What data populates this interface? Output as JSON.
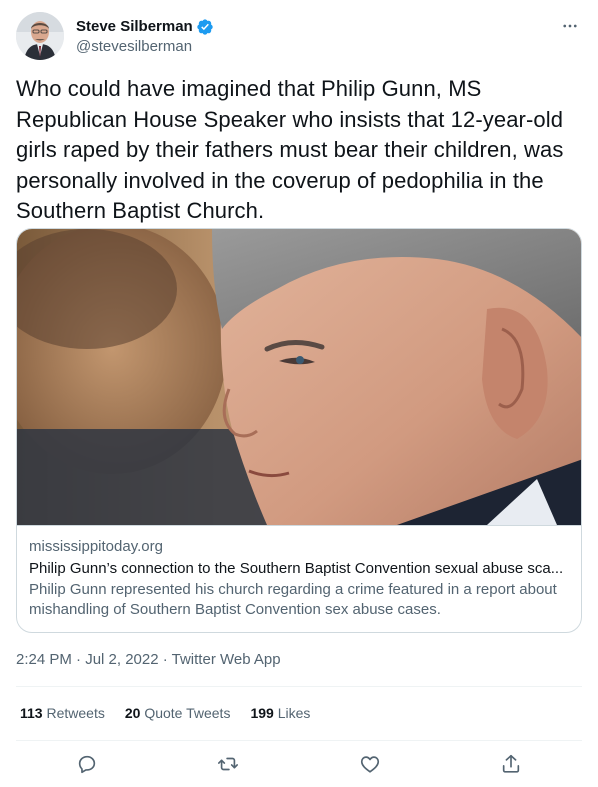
{
  "author": {
    "display_name": "Steve Silberman",
    "handle": "@stevesilberman",
    "verified": true
  },
  "tweet": {
    "text": "Who could have imagined that Philip Gunn, MS Republican House Speaker who insists that 12-year-old girls raped by their fathers must bear their children, was personally involved in the coverup of pedophilia in the Southern Baptist Church."
  },
  "card": {
    "domain": "mississippitoday.org",
    "title": "Philip Gunn’s connection to the Southern Baptist Convention sexual abuse sca...",
    "description": "Philip Gunn represented his church regarding a crime featured in a report about mishandling of Southern Baptist Convention sex abuse cases."
  },
  "meta": {
    "timestamp": "2:24 PM · Jul 2, 2022 · Twitter Web App"
  },
  "stats": {
    "retweets_count": "113",
    "retweets_label": "Retweets",
    "quotes_count": "20",
    "quotes_label": "Quote Tweets",
    "likes_count": "199",
    "likes_label": "Likes"
  },
  "icons": [
    "verified-badge-icon",
    "more-icon",
    "reply-icon",
    "retweet-icon",
    "like-icon",
    "share-icon"
  ],
  "colors": {
    "text": "#0f1419",
    "secondary": "#536471",
    "verified": "#1d9bf0",
    "border": "#cfd9de"
  }
}
